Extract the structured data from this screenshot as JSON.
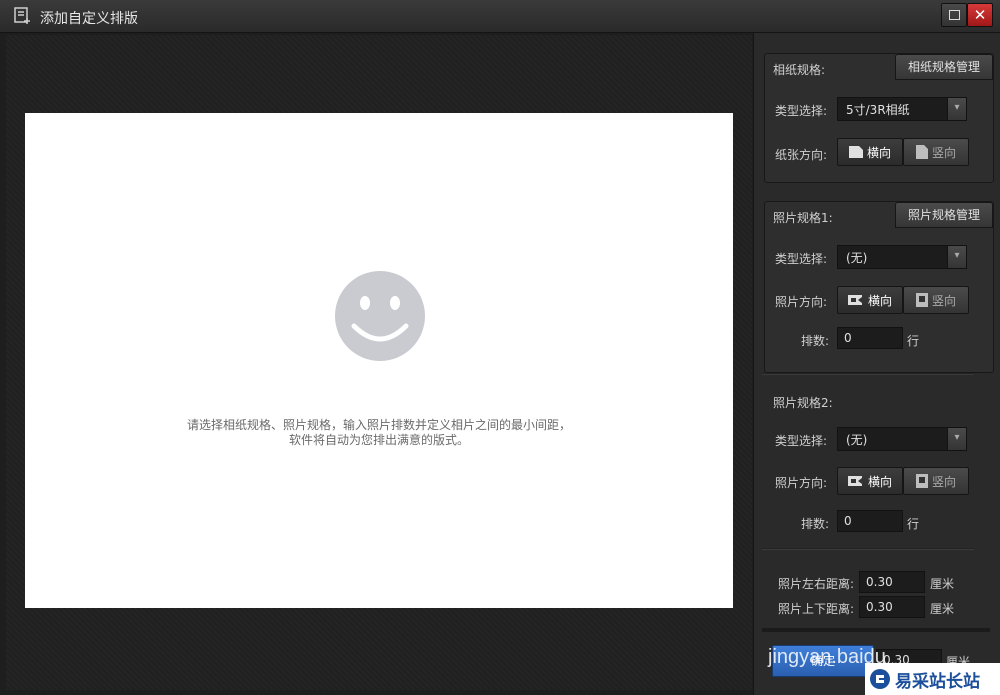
{
  "window": {
    "title": "添加自定义排版"
  },
  "canvas": {
    "hint_line1": "请选择相纸规格、照片规格，输入照片排数并定义相片之间的最小间距，",
    "hint_line2": "软件将自动为您排出满意的版式。"
  },
  "paper_spec": {
    "title": "相纸规格:",
    "manage_label": "相纸规格管理",
    "type_label": "类型选择:",
    "type_value": "5寸/3R相纸",
    "orientation_label": "纸张方向:",
    "landscape_label": "横向",
    "portrait_label": "竖向"
  },
  "photo_spec1": {
    "title": "照片规格1:",
    "manage_label": "照片规格管理",
    "type_label": "类型选择:",
    "type_value": "(无)",
    "orientation_label": "照片方向:",
    "landscape_label": "横向",
    "portrait_label": "竖向",
    "rows_label": "排数:",
    "rows_value": "0",
    "rows_unit": "行"
  },
  "photo_spec2": {
    "title": "照片规格2:",
    "type_label": "类型选择:",
    "type_value": "(无)",
    "orientation_label": "照片方向:",
    "landscape_label": "横向",
    "portrait_label": "竖向",
    "rows_label": "排数:",
    "rows_value": "0",
    "rows_unit": "行"
  },
  "spacing": {
    "lr_label": "照片左右距离:",
    "lr_value": "0.30",
    "lr_unit": "厘米",
    "tb_label": "照片上下距离:",
    "tb_value": "0.30",
    "tb_unit": "厘米",
    "extra_value": "0.30",
    "extra_unit": "厘米"
  },
  "footer": {
    "confirm_label": "确定"
  },
  "overlay": {
    "watermark_text": "jingyan.baidu",
    "site_text": "易采站长站"
  },
  "colors": {
    "accent": "#2f6fc9",
    "close": "#c62828",
    "panel": "#2a2a2a"
  }
}
